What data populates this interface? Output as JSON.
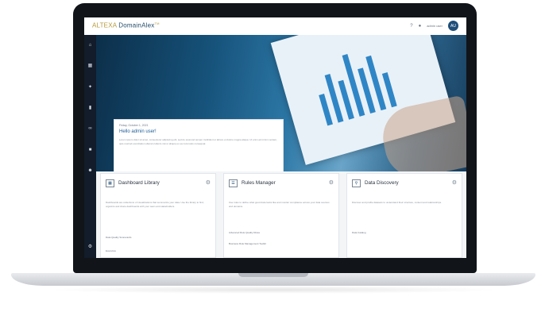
{
  "app": {
    "logo_prefix": "ALTEXA",
    "logo_product": "DomainAlex",
    "logo_mark": "TM",
    "user_label": "admin user",
    "avatar_initials": "AU"
  },
  "sidebar": {
    "icons": [
      "home-icon",
      "dashboard-icon",
      "wrench-icon",
      "book-icon",
      "link-icon",
      "box-icon",
      "users-icon",
      "settings-icon"
    ]
  },
  "hero": {
    "date": "Friday, October 1, 2021",
    "greeting": "Hello admin user!",
    "description": "Lorem ipsum dolor sit amet, consectetur adipiscing elit, sed do eiusmod tempor incididunt ut labore et dolore magna aliqua. Ut enim ad minim veniam, quis nostrud exercitation ullamco laboris nisi ut aliquip ex ea commodo consequat."
  },
  "cards": [
    {
      "title": "Dashboard Library",
      "icon": "dashboard-icon",
      "body": "Dashboards are collections of visualizations that summarize your data. Use the library to find, organize and share dashboards with your team and stakeholders.",
      "links": [
        "Data Quality Scorecards",
        "Executive"
      ]
    },
    {
      "title": "Rules Manager",
      "icon": "rules-icon",
      "body": "Use rules to define what good data looks like and monitor compliance across your data sources and domains.",
      "links": [
        "Advanced Rule Quality Rules",
        "Business Rule Management Toolkit"
      ]
    },
    {
      "title": "Data Discovery",
      "icon": "discovery-icon",
      "body": "Discover and profile datasets to understand their structure, content and relationships.",
      "links": [
        "Data Catalog"
      ]
    }
  ],
  "colors": {
    "accent": "#1f5f99",
    "sidebar": "#121c2a",
    "logo_gold": "#b59a3a"
  }
}
